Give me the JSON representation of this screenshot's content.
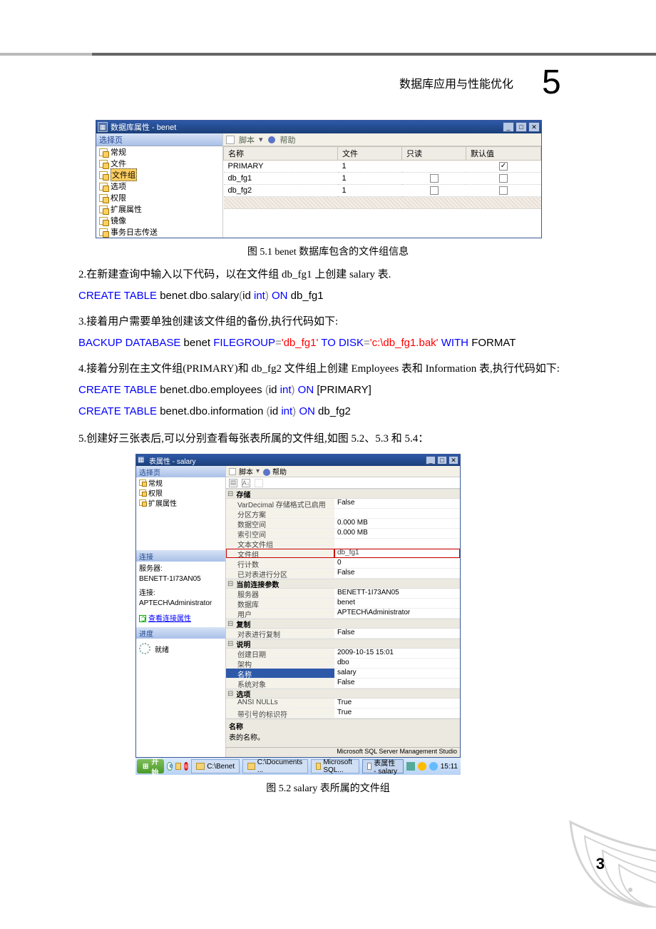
{
  "header": {
    "title": "数据库应用与性能优化",
    "chapter_num": "5"
  },
  "db_window": {
    "title": "数据库属性 - benet",
    "sidebar_header": "选择页",
    "sidebar_items": [
      "常规",
      "文件",
      "文件组",
      "选项",
      "权限",
      "扩展属性",
      "镜像",
      "事务日志传送"
    ],
    "sidebar_selected_index": 2,
    "tb_script": "脚本",
    "tb_help": "帮助",
    "cols": [
      "名称",
      "文件",
      "只读",
      "默认值"
    ],
    "rows": [
      {
        "name": "PRIMARY",
        "files": "1",
        "readonly": "",
        "default": true
      },
      {
        "name": "db_fg1",
        "files": "1",
        "readonly": false,
        "default": false
      },
      {
        "name": "db_fg2",
        "files": "1",
        "readonly": false,
        "default": false
      }
    ]
  },
  "caption1": "图 5.1 benet 数据库包含的文件组信息",
  "para2": "2.在新建查询中输入以下代码，以在文件组 db_fg1 上创建 salary 表.",
  "code1": {
    "pre": "CREATE TABLE ",
    "mid": "benet",
    "dot1": ".",
    "mid2": "dbo",
    "dot2": ".",
    "mid3": "salary",
    "paren": "(",
    "col": "id ",
    "typ": "int",
    "paren2": ")",
    "on": " ON ",
    "fg": "db_fg1"
  },
  "para3": "3.接着用户需要单独创建该文件组的备份,执行代码如下:",
  "code2": {
    "pre": " BACKUP DATABASE ",
    "db": "benet ",
    "fk": "FILEGROUP",
    "eq": "=",
    "s1": "'db_fg1'",
    "to": " TO DISK",
    "eq2": "=",
    "s2": "'c:\\db_fg1.bak'",
    "with": " WITH ",
    "fmt": "FORMAT"
  },
  "para4": "4.接着分别在主文件组(PRIMARY)和 db_fg2 文件组上创建 Employees 表和 Information 表,执行代码如下:",
  "code3_a": {
    "pre": "CREATE TABLE ",
    "p": "benet.dbo.employees ",
    "pr": "(",
    "c": "id ",
    "t": "int",
    "pr2": ")",
    "on": " ON ",
    "fg": "[PRIMARY]"
  },
  "code3_b": {
    "pre": "CREATE TABLE ",
    "p": "benet.dbo.information ",
    "pr": "(",
    "c": "id ",
    "t": "int",
    "pr2": ")",
    "on": " ON ",
    "fg": "db_fg2"
  },
  "para5": "5.创建好三张表后,可以分别查看每张表所属的文件组,如图 5.2、5.3 和 5.4：",
  "tp": {
    "title": "表属性 - salary",
    "sidebar_header": "选择页",
    "sidebar_items": [
      "常规",
      "权限",
      "扩展属性"
    ],
    "conn_header": "连接",
    "server_lbl": "服务器:",
    "server": "BENETT-1I73AN05",
    "conn_lbl": "连接:",
    "conn": "APTECH\\Administrator",
    "view_link": "查看连接属性",
    "prog_header": "进度",
    "prog_state": "就绪",
    "tb_script": "脚本",
    "tb_help": "帮助",
    "sect_storage": "存储",
    "rows_storage": [
      {
        "k": "VarDecimal 存储格式已启用",
        "v": "False"
      },
      {
        "k": "分区方案",
        "v": ""
      },
      {
        "k": "数据空间",
        "v": "0.000 MB"
      },
      {
        "k": "索引空间",
        "v": "0.000 MB"
      },
      {
        "k": "文本文件组",
        "v": ""
      },
      {
        "k": "文件组",
        "v": "db_fg1",
        "hl": true
      },
      {
        "k": "行计数",
        "v": "0"
      },
      {
        "k": "已对表进行分区",
        "v": "False"
      }
    ],
    "sect_conn": "当前连接参数",
    "rows_conn": [
      {
        "k": "服务器",
        "v": "BENETT-1I73AN05"
      },
      {
        "k": "数据库",
        "v": "benet"
      },
      {
        "k": "用户",
        "v": "APTECH\\Administrator"
      }
    ],
    "sect_rep": "复制",
    "rows_rep": [
      {
        "k": "对表进行复制",
        "v": "False"
      }
    ],
    "sect_desc": "说明",
    "rows_desc": [
      {
        "k": "创建日期",
        "v": "2009-10-15 15:01"
      },
      {
        "k": "架构",
        "v": "dbo"
      },
      {
        "k": "名称",
        "v": "salary",
        "sel": true
      },
      {
        "k": "系统对象",
        "v": "False"
      }
    ],
    "sect_opt": "选项",
    "rows_opt": [
      {
        "k": "ANSI NULLs",
        "v": "True"
      },
      {
        "k": "带引号的标识符",
        "v": "True"
      }
    ],
    "desc_title": "名称",
    "desc_body": "表的名称。",
    "status": "Microsoft SQL Server Management Studio"
  },
  "taskbar": {
    "start": "开始",
    "items": [
      {
        "t": "C:\\Benet",
        "type": "folder"
      },
      {
        "t": "C:\\Documents ...",
        "type": "folder"
      },
      {
        "t": "Microsoft SQL...",
        "type": "app"
      },
      {
        "t": "表属性 - salary",
        "type": "win",
        "active": true
      }
    ],
    "time": "15:11"
  },
  "caption2": "图 5.2 salary 表所属的文件组",
  "page_number": "3"
}
